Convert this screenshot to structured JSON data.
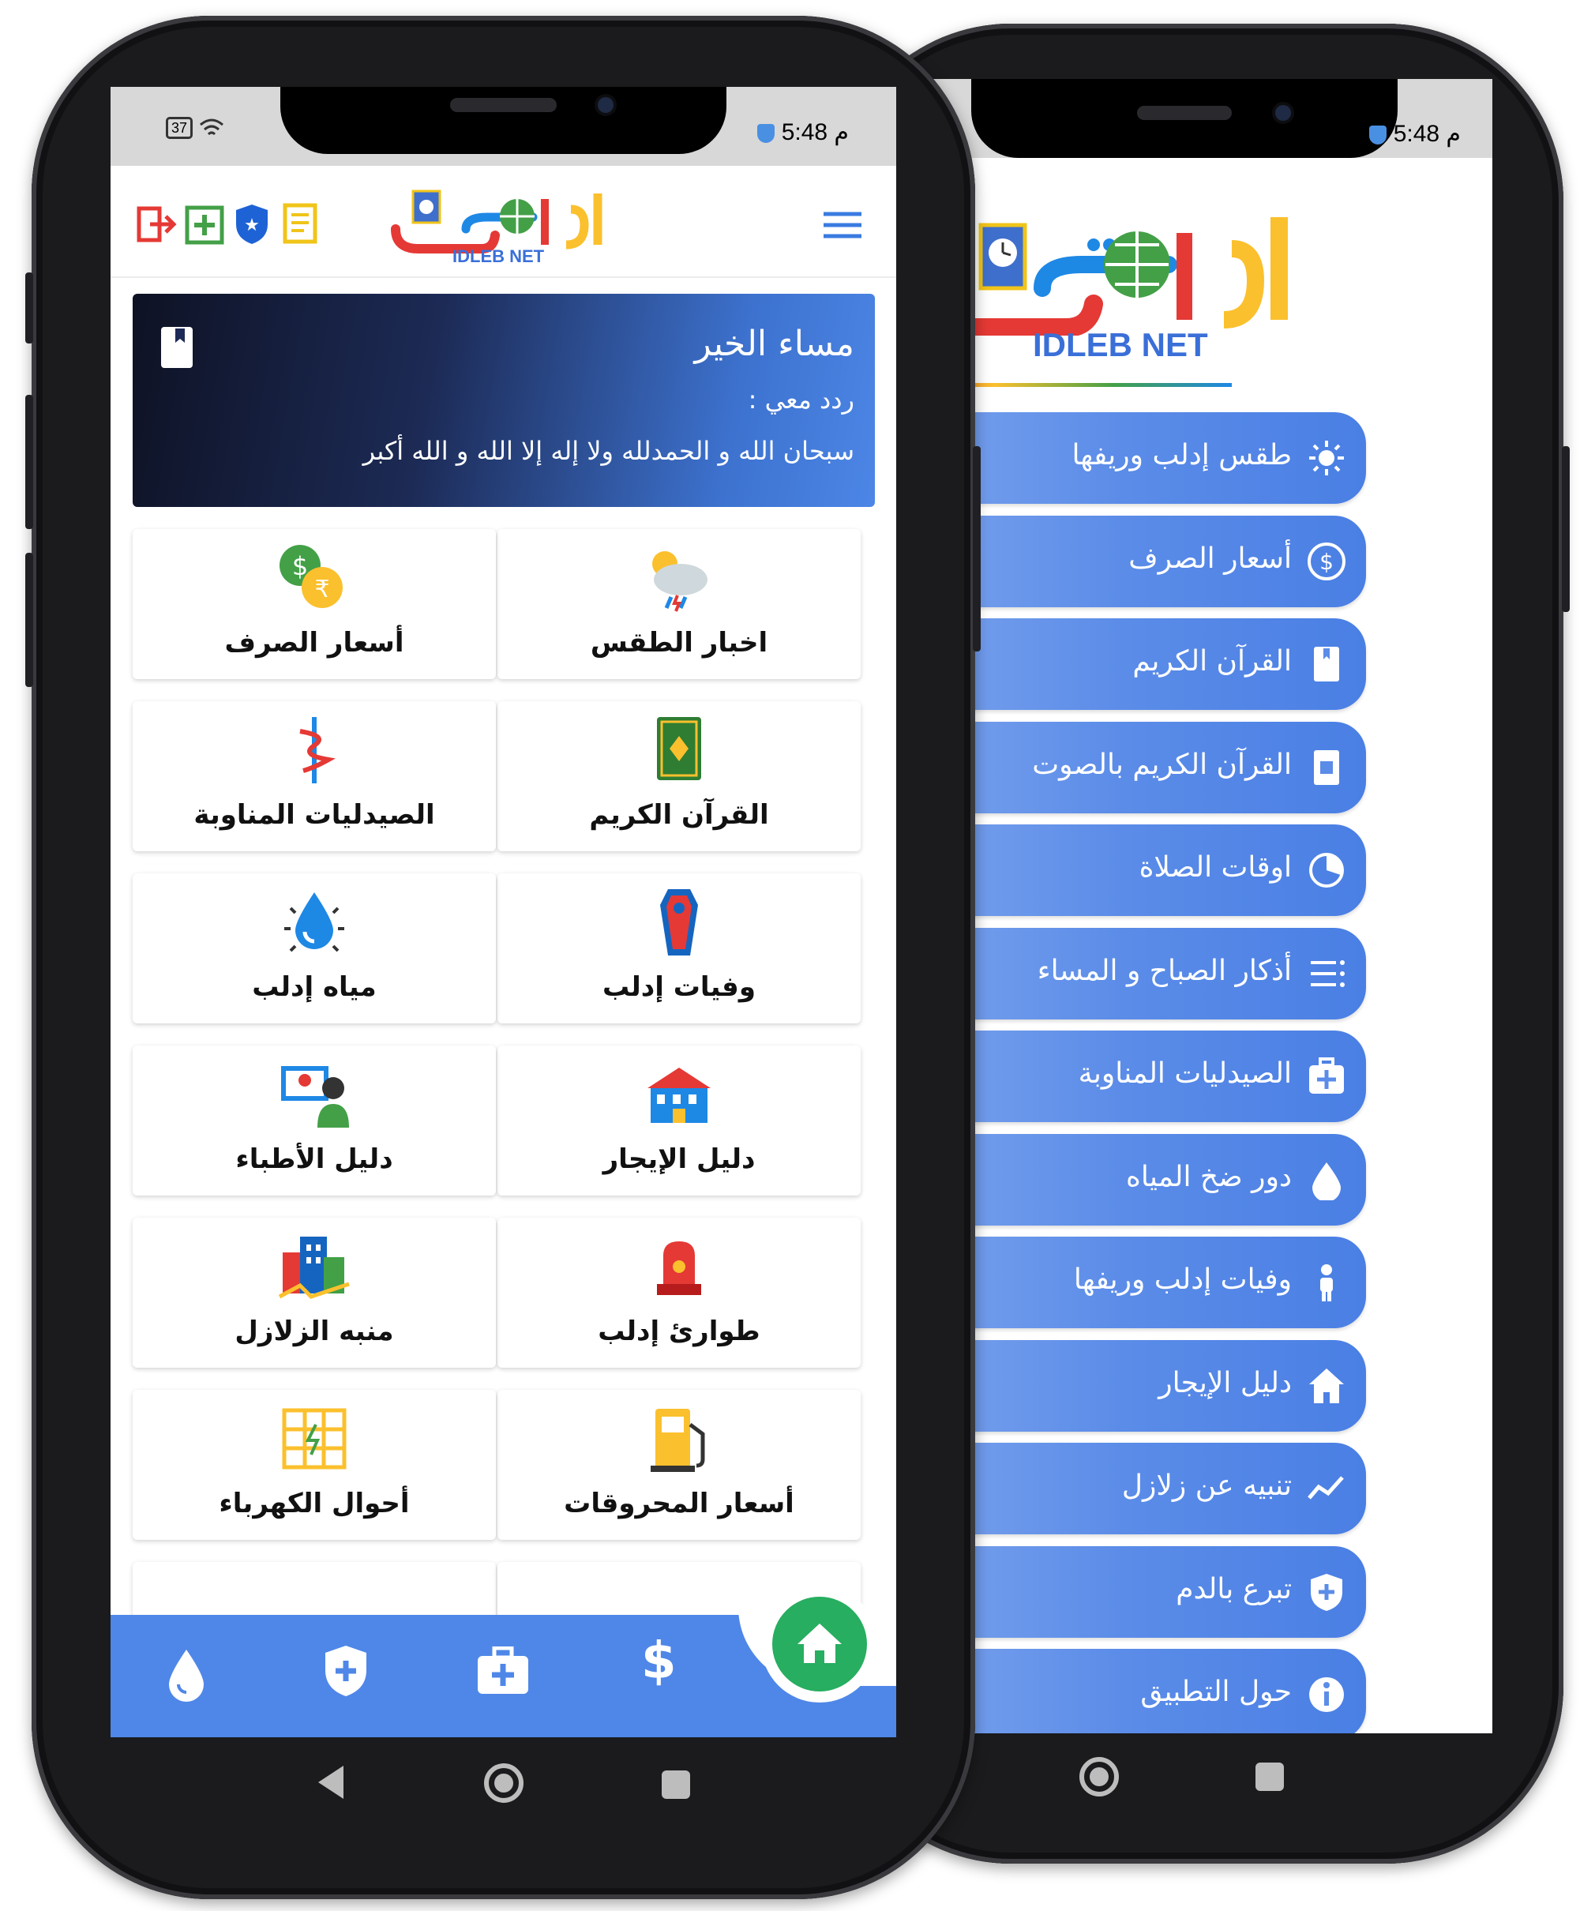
{
  "left_phone": {
    "status": {
      "time": "5:48",
      "suffix": "م",
      "battery": "37"
    },
    "logo": {
      "arabic": "إدلب نت",
      "english": "IDLEB NET"
    },
    "header_icons": [
      "logout-icon",
      "add-icon",
      "shield-icon",
      "news-icon"
    ],
    "greeting": {
      "title": "مساء الخير",
      "subtitle": "ردد معي :",
      "dhikr": "سبحان الله و الحمدلله ولا إله إلا الله و الله أكبر"
    },
    "grid": [
      {
        "label": "اخبار الطقس",
        "icon": "weather-icon"
      },
      {
        "label": "أسعار الصرف",
        "icon": "currency-icon"
      },
      {
        "label": "القرآن الكريم",
        "icon": "quran-icon"
      },
      {
        "label": "الصيدليات المناوبة",
        "icon": "pharmacy-icon"
      },
      {
        "label": "وفيات إدلب",
        "icon": "coffin-icon"
      },
      {
        "label": "مياه إدلب",
        "icon": "water-icon"
      },
      {
        "label": "دليل الإيجار",
        "icon": "building-icon"
      },
      {
        "label": "دليل الأطباء",
        "icon": "doctor-icon"
      },
      {
        "label": "طوارئ إدلب",
        "icon": "siren-icon"
      },
      {
        "label": "منبه الزلازل",
        "icon": "earthquake-icon"
      },
      {
        "label": "أسعار المحروقات",
        "icon": "fuel-icon"
      },
      {
        "label": "أحوال الكهرباء",
        "icon": "electricity-icon"
      }
    ],
    "bottom_nav": [
      "water-icon",
      "shield-plus-icon",
      "medical-kit-icon",
      "dollar-icon",
      "home-icon"
    ]
  },
  "right_phone": {
    "status": {
      "time": "5:48",
      "suffix": "م"
    },
    "logo": {
      "arabic": "إدلب نت",
      "english": "IDLEB NET"
    },
    "menu": [
      {
        "label": "طقس إدلب وريفها",
        "icon": "sun-icon"
      },
      {
        "label": "أسعار الصرف",
        "icon": "dollar-circle-icon"
      },
      {
        "label": "القرآن الكريم",
        "icon": "book-icon"
      },
      {
        "label": "القرآن الكريم بالصوت",
        "icon": "audio-book-icon"
      },
      {
        "label": "اوقات الصلاة",
        "icon": "clock-icon"
      },
      {
        "label": "أذكار الصباح و المساء",
        "icon": "list-icon"
      },
      {
        "label": "الصيدليات المناوبة",
        "icon": "medkit-icon"
      },
      {
        "label": "دور ضخ المياه",
        "icon": "drop-icon"
      },
      {
        "label": "وفيات إدلب وريفها",
        "icon": "person-icon"
      },
      {
        "label": "دليل الإيجار",
        "icon": "house-icon"
      },
      {
        "label": "تنبيه عن زلازل",
        "icon": "chart-line-icon"
      },
      {
        "label": "تبرع بالدم",
        "icon": "shield-plus-icon"
      },
      {
        "label": "حول التطبيق",
        "icon": "info-icon"
      }
    ]
  }
}
